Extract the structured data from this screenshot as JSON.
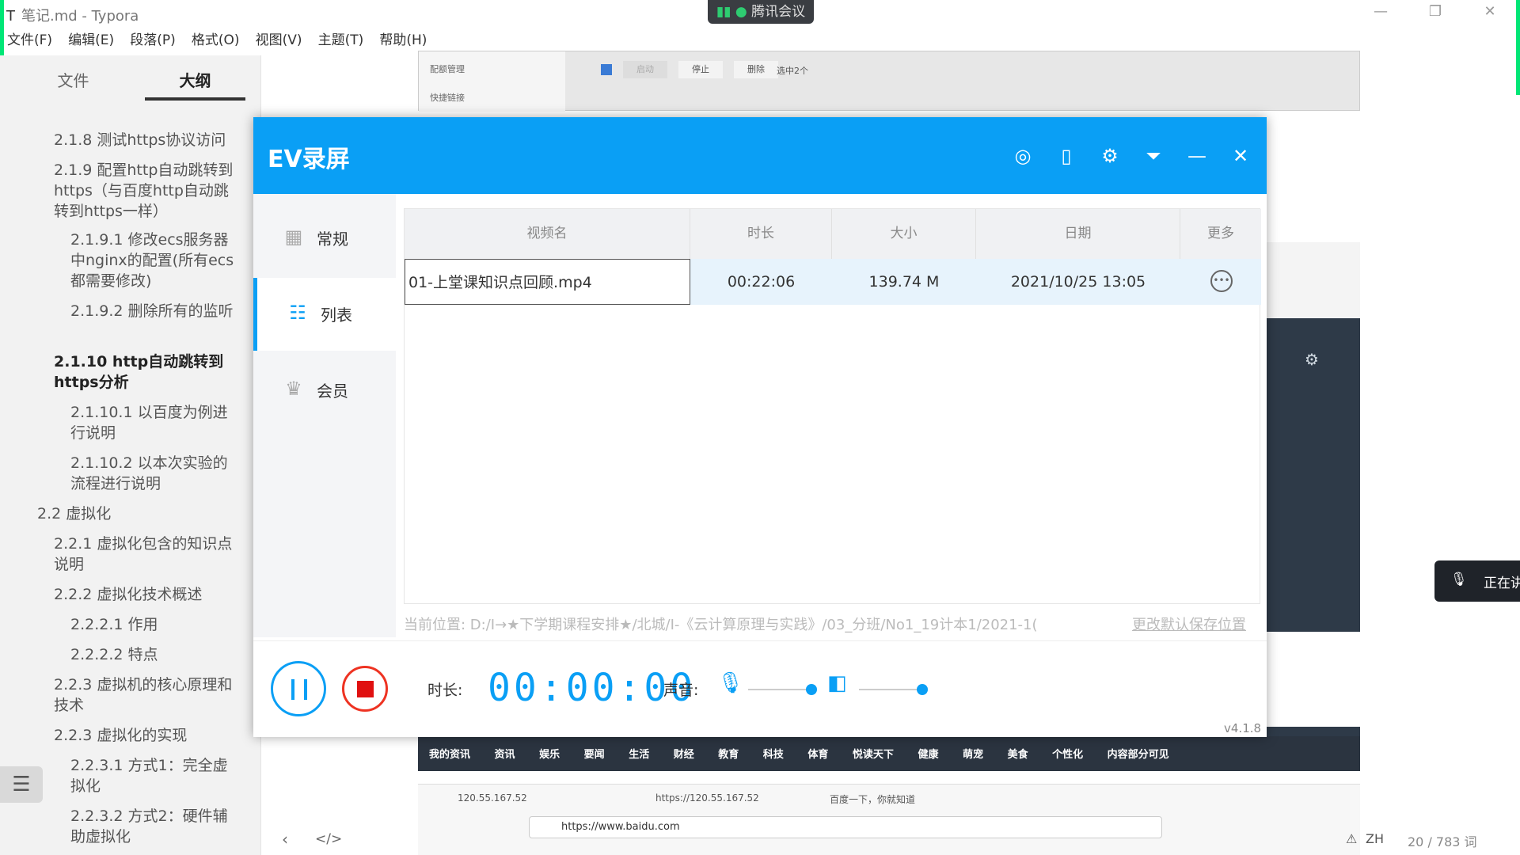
{
  "typora": {
    "title": "笔记.md - Typora",
    "app_icon": "T",
    "menus": [
      "文件(F)",
      "编辑(E)",
      "段落(P)",
      "格式(O)",
      "视图(V)",
      "主题(T)",
      "帮助(H)"
    ],
    "tabs": {
      "files": "文件",
      "outline": "大纲"
    },
    "outline": [
      "2.1.8 测试https协议访问",
      "2.1.9 配置http自动跳转到https（与百度http自动跳转到https一样）",
      "2.1.9.1 修改ecs服务器中nginx的配置(所有ecs都需要修改)",
      "2.1.9.2 删除所有的监听",
      "2.1.10 http自动跳转到https分析",
      "2.1.10.1 以百度为例进行说明",
      "2.1.10.2 以本次实验的流程进行说明",
      "2.2 虚拟化",
      "2.2.1 虚拟化包含的知识点说明",
      "2.2.2 虚拟化技术概述",
      "2.2.2.1 作用",
      "2.2.2.2 特点",
      "2.2.3 虚拟机的核心原理和技术",
      "2.2.3 虚拟化的实现",
      "2.2.3.1 方式1：完全虚拟化",
      "2.2.3.2 方式2：硬件辅助虚拟化"
    ],
    "status": {
      "lang": "ZH",
      "word_count": "20 / 783 词"
    }
  },
  "tencent_meeting": "腾讯会议",
  "meeting_toast": "正在讲",
  "ev": {
    "title": "EV录屏",
    "nav": [
      "常规",
      "列表",
      "会员"
    ],
    "table": {
      "headers": [
        "视频名",
        "时长",
        "大小",
        "日期",
        "更多"
      ],
      "rows": [
        {
          "name": "01-上堂课知识点回顾.mp4",
          "duration": "00:22:06",
          "size": "139.74 M",
          "date": "2021/10/25 13:05"
        }
      ]
    },
    "save_path": "当前位置: D:/Ⅰ→★下学期课程安排★/北城/Ⅰ-《云计算原理与实践》/03_分班/No1_19计本1/2021-1(",
    "change_path": "更改默认保存位置",
    "duration_label": "时长:",
    "timer": "00:00:00",
    "sound_label": "声音:",
    "version": "v4.1.8"
  },
  "browser": {
    "tabs": [
      "120.55.167.52",
      "https://120.55.167.52",
      "百度一下，你就知道"
    ],
    "url": "https://www.baidu.com",
    "news_nav": [
      "我的资讯",
      "资讯",
      "娱乐",
      "要闻",
      "生活",
      "财经",
      "教育",
      "科技",
      "体育",
      "悦读天下",
      "健康",
      "萌宠",
      "美食",
      "个性化",
      "内容部分可见"
    ]
  },
  "bg_fragment": {
    "items": [
      "配额管理",
      "快捷链接",
      "启动",
      "停止",
      "删除",
      "选中2个"
    ]
  }
}
